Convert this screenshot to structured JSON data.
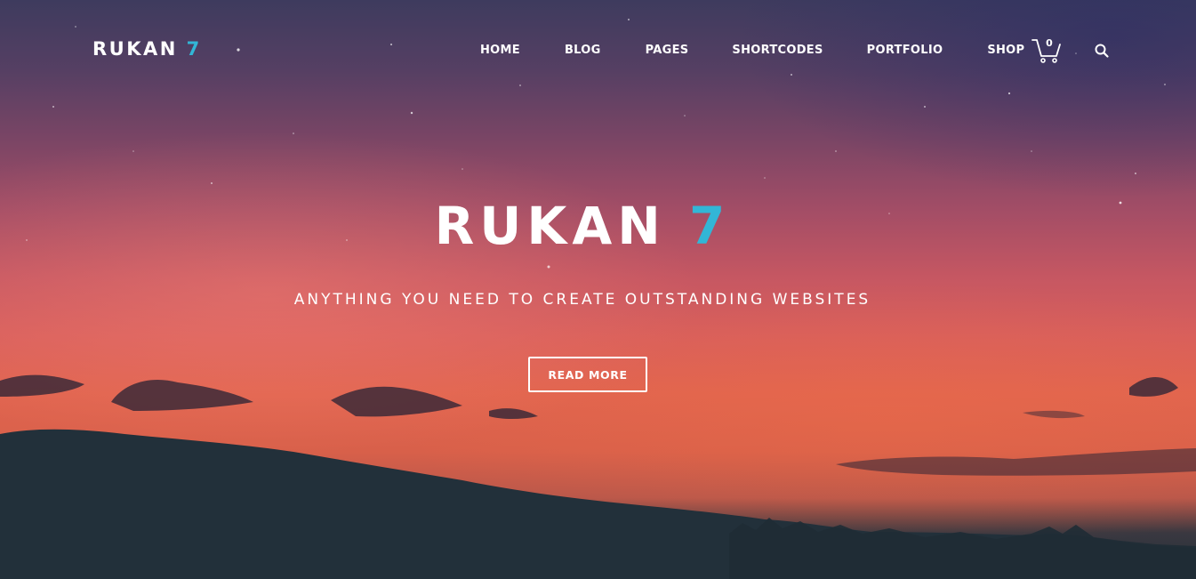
{
  "header": {
    "logo_text": "RUKAN",
    "logo_number": "7"
  },
  "nav": {
    "items": [
      {
        "label": "HOME"
      },
      {
        "label": "BLOG"
      },
      {
        "label": "PAGES"
      },
      {
        "label": "SHORTCODES"
      },
      {
        "label": "PORTFOLIO"
      },
      {
        "label": "SHOP"
      }
    ],
    "cart_count": "0",
    "cart_icon": "cart-icon",
    "search_icon": "search-icon"
  },
  "hero": {
    "title_text": "RUKAN",
    "title_number": "7",
    "subtitle": "ANYTHING YOU NEED TO CREATE OUTSTANDING WEBSITES",
    "button_label": "READ MORE"
  },
  "colors": {
    "accent": "#32b6d6",
    "text": "#ffffff",
    "ground": "#22303a"
  }
}
